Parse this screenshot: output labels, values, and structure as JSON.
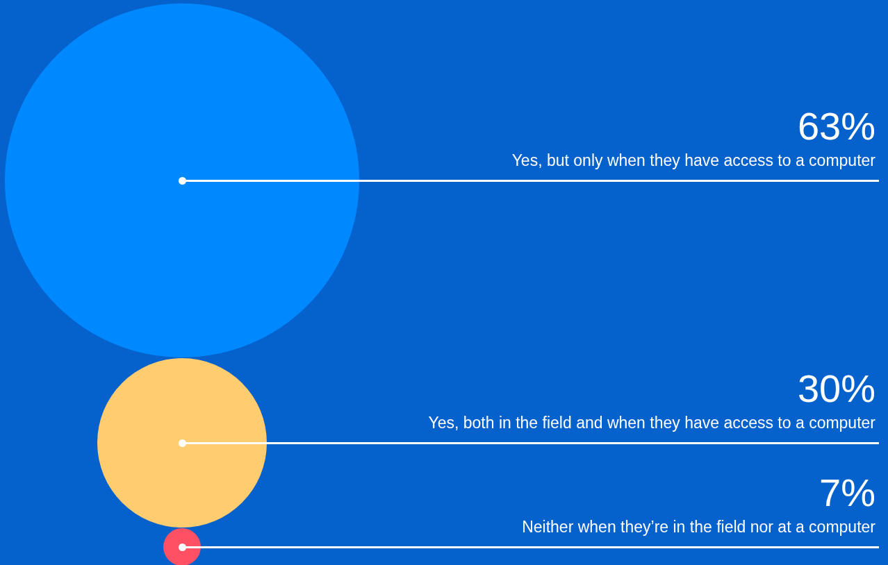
{
  "items": [
    {
      "percent": "63%",
      "label": "Yes, but only when they have access to a computer",
      "color": "#0088ff"
    },
    {
      "percent": "30%",
      "label": "Yes, both in the field and when they have access to a computer",
      "color": "#ffcc70"
    },
    {
      "percent": "7%",
      "label": "Neither when they’re in the field nor at a computer",
      "color": "#ff5064"
    }
  ]
}
